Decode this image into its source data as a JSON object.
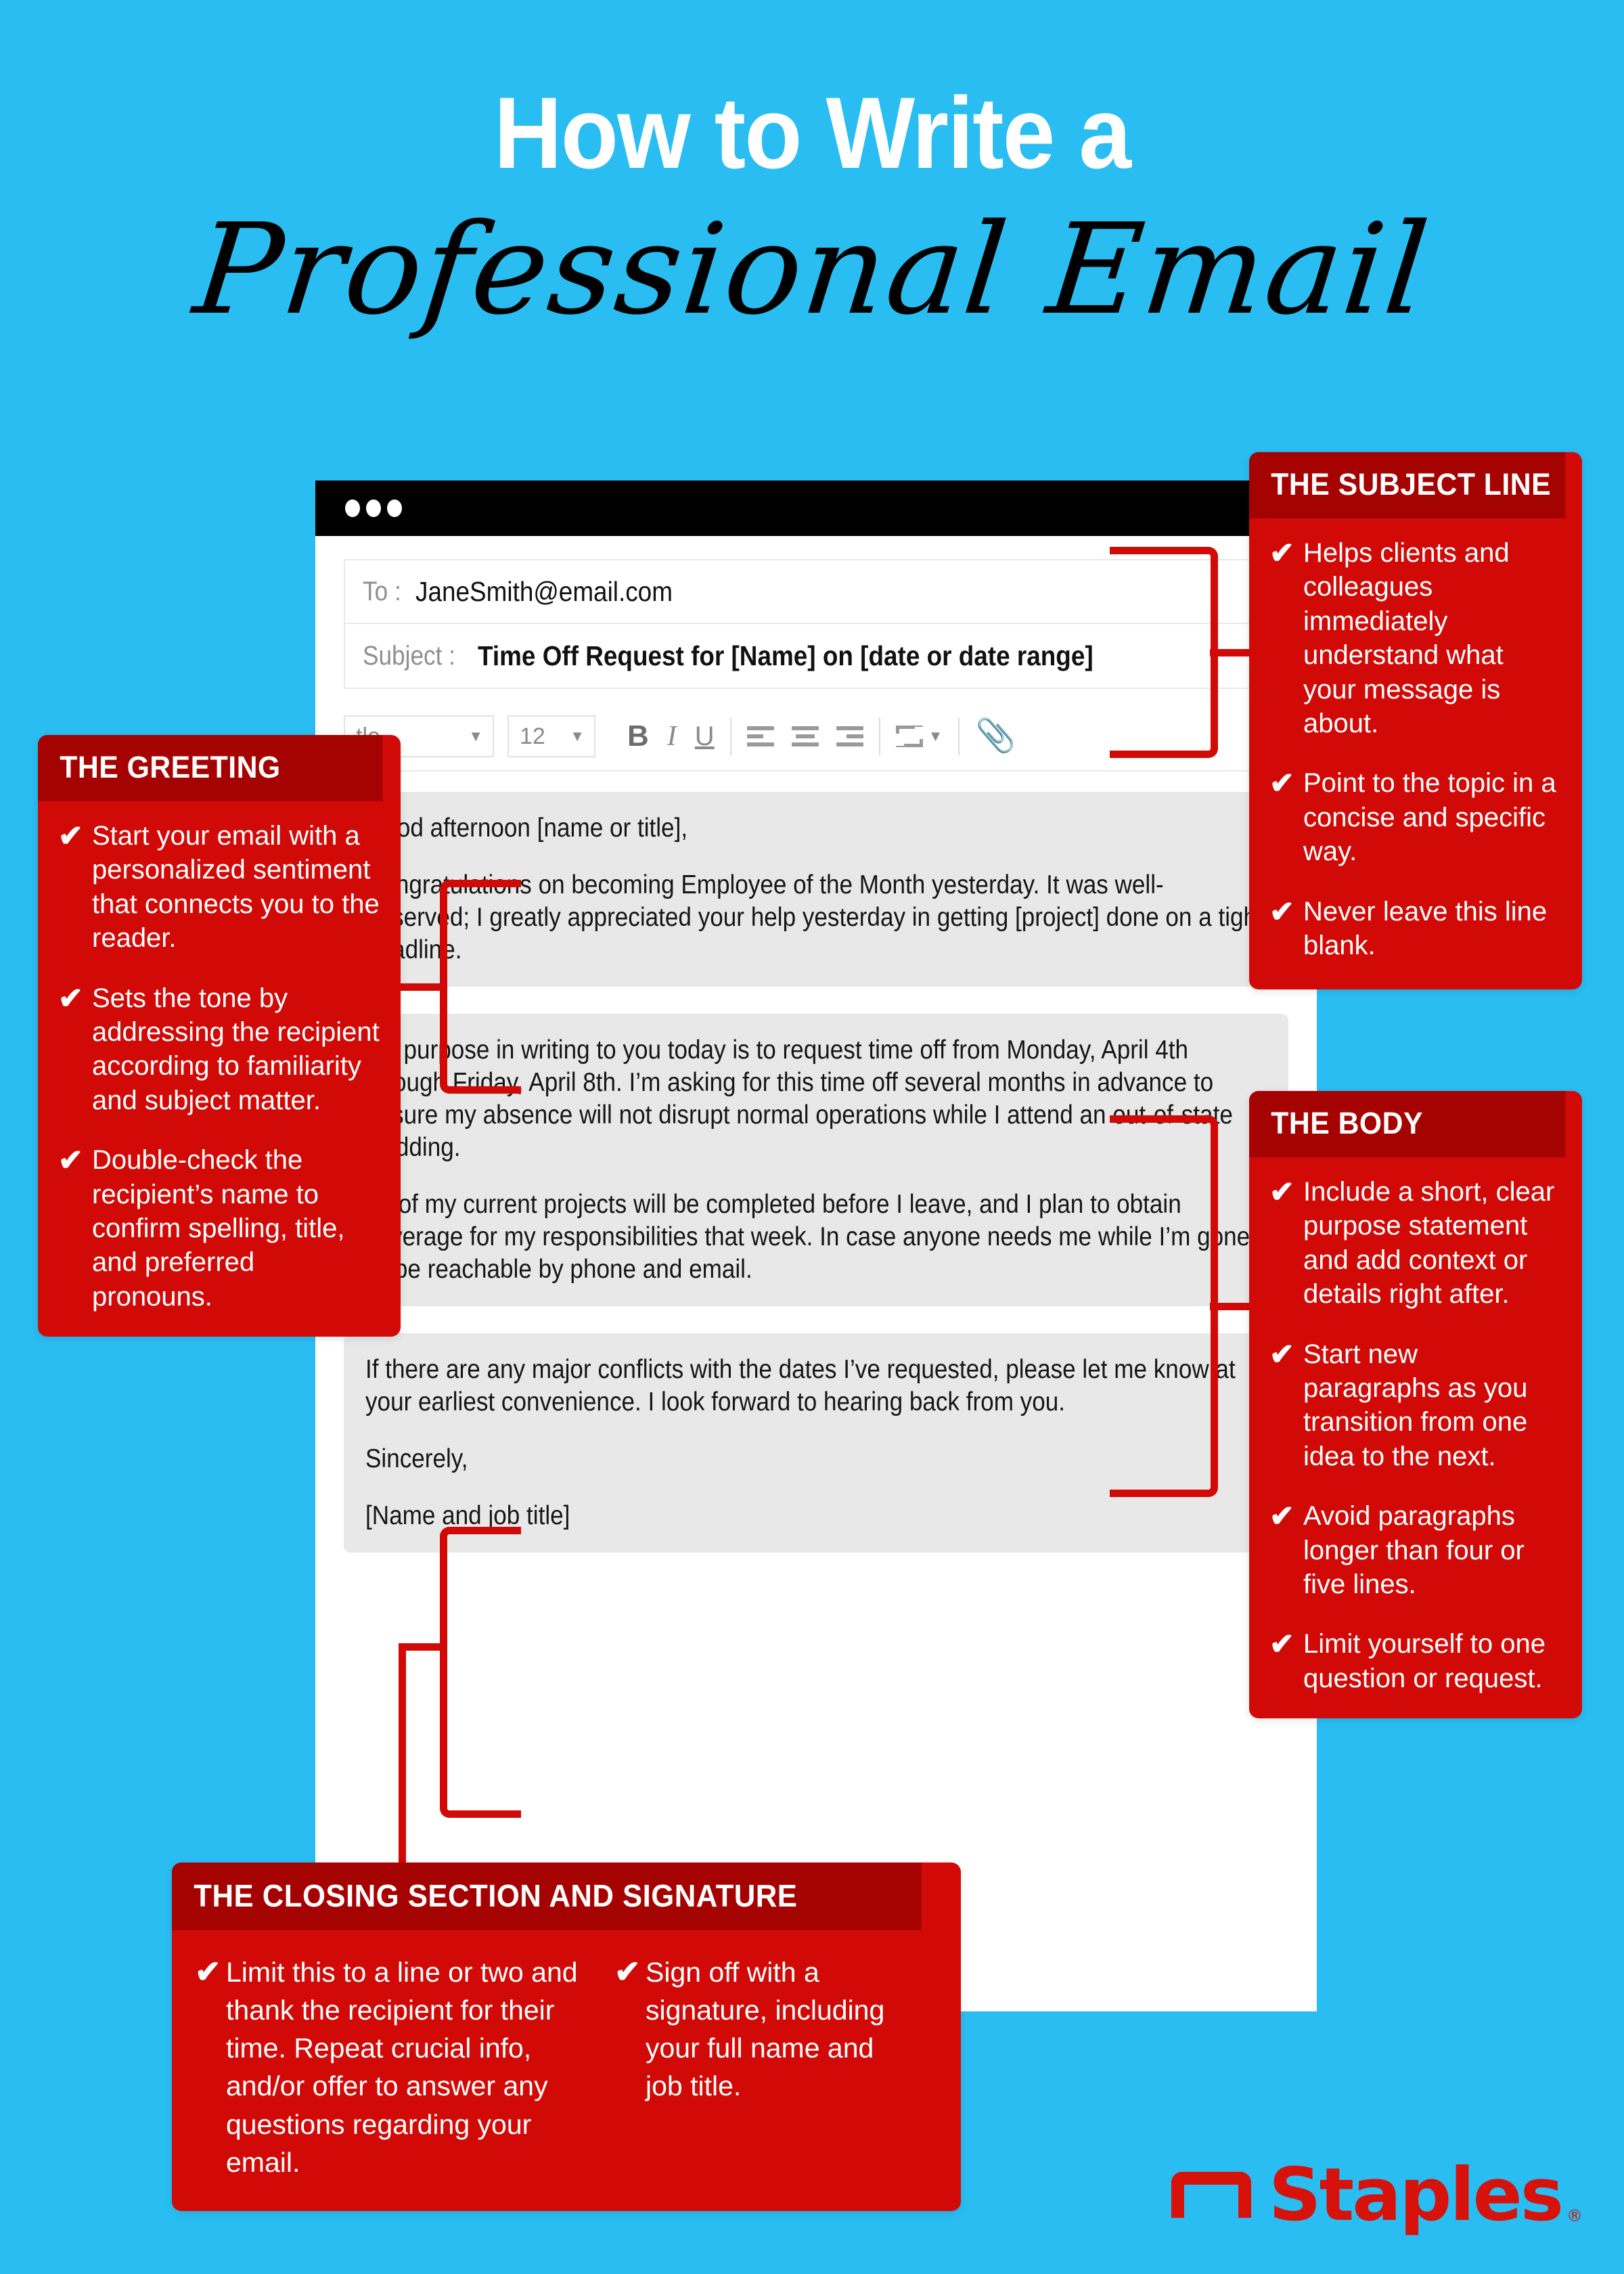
{
  "theme": {
    "background_blue": "#29BDF2",
    "callout_red": "#D20A07",
    "callout_header_red": "#A50302",
    "brand_red": "#D6120B",
    "message_block_gray": "#E8E8E8"
  },
  "title": {
    "line1": "How to Write a",
    "line2": "Professional Email"
  },
  "email_window": {
    "titlebar_dots": 3,
    "fields": [
      {
        "label": "To :",
        "value": "JaneSmith@email.com"
      },
      {
        "label": "Subject :",
        "value": "Time Off Request for [Name] on [date or date range]"
      }
    ],
    "toolbar": {
      "font_family": "tle",
      "font_size": "12",
      "bold_label": "B",
      "italic_label": "I",
      "underline_label": "U",
      "align_left": "align-left-icon",
      "align_center": "align-center-icon",
      "align_right": "align-right-icon",
      "insert_media": "insert-media-icon",
      "attach": "📎"
    },
    "message_blocks": [
      {
        "id": "greeting",
        "paragraphs": [
          "Good afternoon [name or title],",
          "Congratulations on becoming Employee of the Month yesterday. It was well-deserved; I greatly appreciated your help yesterday in getting [project] done on a tight deadline."
        ]
      },
      {
        "id": "body",
        "paragraphs": [
          "My purpose in writing to you today is to request time off from Monday, April 4th through Friday, April 8th. I’m asking for this time off several months in advance to ensure my absence will not disrupt normal operations while I attend an out-of-state wedding.",
          "All of my current projects will be completed before I leave, and I plan to obtain coverage for my responsibilities that week. In case anyone needs me while I’m gone, I’ll be reachable by phone and email."
        ]
      },
      {
        "id": "closing",
        "paragraphs": [
          "If there are any major conflicts with the dates I’ve requested, please let me know at your earliest convenience. I look forward to hearing back from you.",
          "Sincerely,",
          "[Name and job title]"
        ]
      }
    ]
  },
  "callouts": {
    "subject_line": {
      "header": "THE SUBJECT LINE",
      "bullets": [
        "Helps clients and colleagues immediately understand what your message is about.",
        "Point to the topic in a concise and specific way.",
        "Never leave this line blank."
      ]
    },
    "greeting": {
      "header": "THE GREETING",
      "bullets": [
        "Start your email with a personalized sentiment that connects you to the reader.",
        "Sets the tone by addressing the recipient according to familiarity and subject matter.",
        "Double-check the recipient’s name to confirm spelling, title, and preferred pronouns."
      ]
    },
    "body": {
      "header": "THE BODY",
      "bullets": [
        "Include a short, clear purpose statement and add context or details right after.",
        "Start new paragraphs as you transition from one idea to the next.",
        "Avoid paragraphs longer than four or five lines.",
        "Limit yourself to one question or request."
      ]
    },
    "closing": {
      "header": "THE CLOSING SECTION AND SIGNATURE",
      "bullets_left": [
        "Limit this to a line or two and thank the recipient for their time. Repeat crucial info, and/or offer to answer any questions regarding your email."
      ],
      "bullets_right": [
        "Sign off with a signature, including your full name and job title."
      ]
    }
  },
  "check_glyph": "✔",
  "brand": {
    "name": "Staples",
    "registered_mark": "®"
  }
}
